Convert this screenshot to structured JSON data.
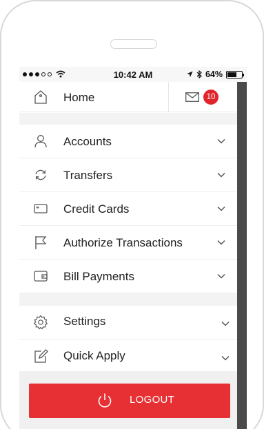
{
  "status_bar": {
    "time": "10:42 AM",
    "battery": "64%",
    "battery_level": 0.64
  },
  "home": {
    "label": "Home",
    "unread_count": "10"
  },
  "menu_items": [
    {
      "label": "Accounts",
      "icon": "user-icon"
    },
    {
      "label": "Transfers",
      "icon": "transfer-icon"
    },
    {
      "label": "Credit Cards",
      "icon": "credit-card-icon"
    },
    {
      "label": "Authorize Transactions",
      "icon": "flag-icon"
    },
    {
      "label": "Bill Payments",
      "icon": "wallet-icon"
    }
  ],
  "secondary_items": [
    {
      "label": "Settings",
      "icon": "gear-icon"
    },
    {
      "label": "Quick Apply",
      "icon": "edit-form-icon"
    }
  ],
  "logout": {
    "label": "LOGOUT"
  },
  "colors": {
    "accent": "#e63034",
    "badge": "#e0262b",
    "scrollbar": "#4a4a4a"
  }
}
